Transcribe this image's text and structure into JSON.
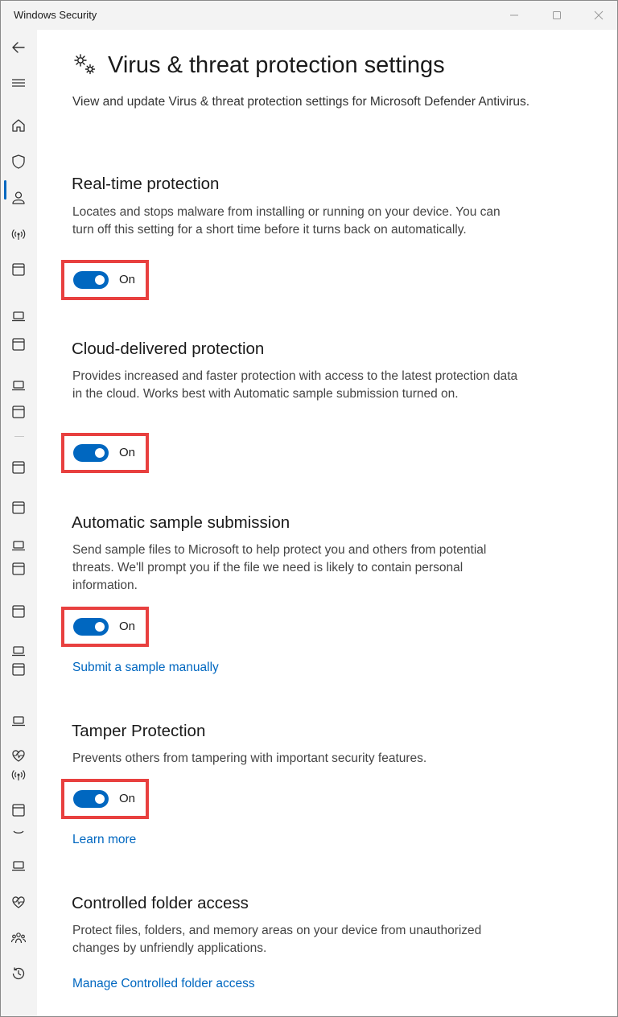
{
  "window": {
    "title": "Windows Security"
  },
  "sidebar": {
    "items": [
      {
        "icon": "back-arrow-icon"
      },
      {
        "icon": "hamburger-menu-icon"
      },
      {
        "icon": "home-icon"
      },
      {
        "icon": "shield-icon",
        "active": true
      },
      {
        "icon": "person-icon"
      },
      {
        "icon": "wireless-icon"
      },
      {
        "icon": "app-window-icon"
      },
      {
        "icon": "laptop-icon"
      },
      {
        "icon": "heartbeat-icon"
      },
      {
        "icon": "family-icon"
      },
      {
        "icon": "history-icon"
      }
    ]
  },
  "page": {
    "title": "Virus & threat protection settings",
    "description": "View and update Virus & threat protection settings for Microsoft Defender Antivirus."
  },
  "sections": [
    {
      "title": "Real-time protection",
      "description": "Locates and stops malware from installing or running on your device. You can turn off this setting for a short time before it turns back on automatically.",
      "toggle_label": "On",
      "toggle_on": true
    },
    {
      "title": "Cloud-delivered protection",
      "description": "Provides increased and faster protection with access to the latest protection data in the cloud. Works best with Automatic sample submission turned on.",
      "toggle_label": "On",
      "toggle_on": true
    },
    {
      "title": "Automatic sample submission",
      "description": "Send sample files to Microsoft to help protect you and others from potential threats. We'll prompt you if the file we need is likely to contain personal information.",
      "toggle_label": "On",
      "toggle_on": true,
      "link": "Submit a sample manually"
    },
    {
      "title": "Tamper Protection",
      "description": "Prevents others from tampering with important security features.",
      "toggle_label": "On",
      "toggle_on": true,
      "link": "Learn more"
    },
    {
      "title": "Controlled folder access",
      "description": "Protect files, folders, and memory areas on your device from unauthorized changes by unfriendly applications.",
      "link": "Manage Controlled folder access"
    }
  ],
  "colors": {
    "accent": "#0067c0",
    "highlight_box": "#e8403f",
    "sidebar_bg": "#f3f3f3"
  }
}
